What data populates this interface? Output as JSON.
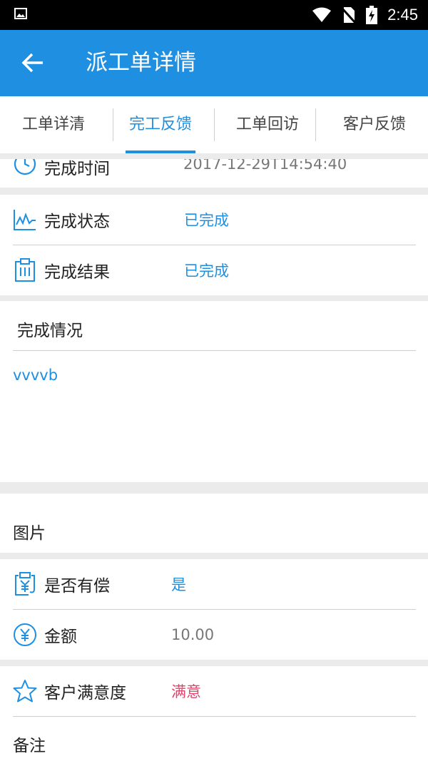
{
  "status_bar": {
    "time": "2:45"
  },
  "app_bar": {
    "title": "派工单详情"
  },
  "tabs": [
    {
      "label": "工单详清"
    },
    {
      "label": "完工反馈"
    },
    {
      "label": "工单回访"
    },
    {
      "label": "客户反馈"
    }
  ],
  "completion": {
    "time_label": "完成时间",
    "time_value": "2017-12-29T14:54:40",
    "status_label": "完成状态",
    "status_value": "已完成",
    "result_label": "完成结果",
    "result_value": "已完成",
    "situation_label": "完成情况",
    "situation_value": "vvvvb"
  },
  "pictures": {
    "label": "图片"
  },
  "payment": {
    "paid_label": "是否有偿",
    "paid_value": "是",
    "amount_label": "金额",
    "amount_value": "10.00"
  },
  "satisfaction": {
    "label": "客户满意度",
    "value": "满意"
  },
  "remarks": {
    "label": "备注"
  },
  "colors": {
    "primary": "#1e8fe1",
    "satisfied": "#e0436b"
  }
}
